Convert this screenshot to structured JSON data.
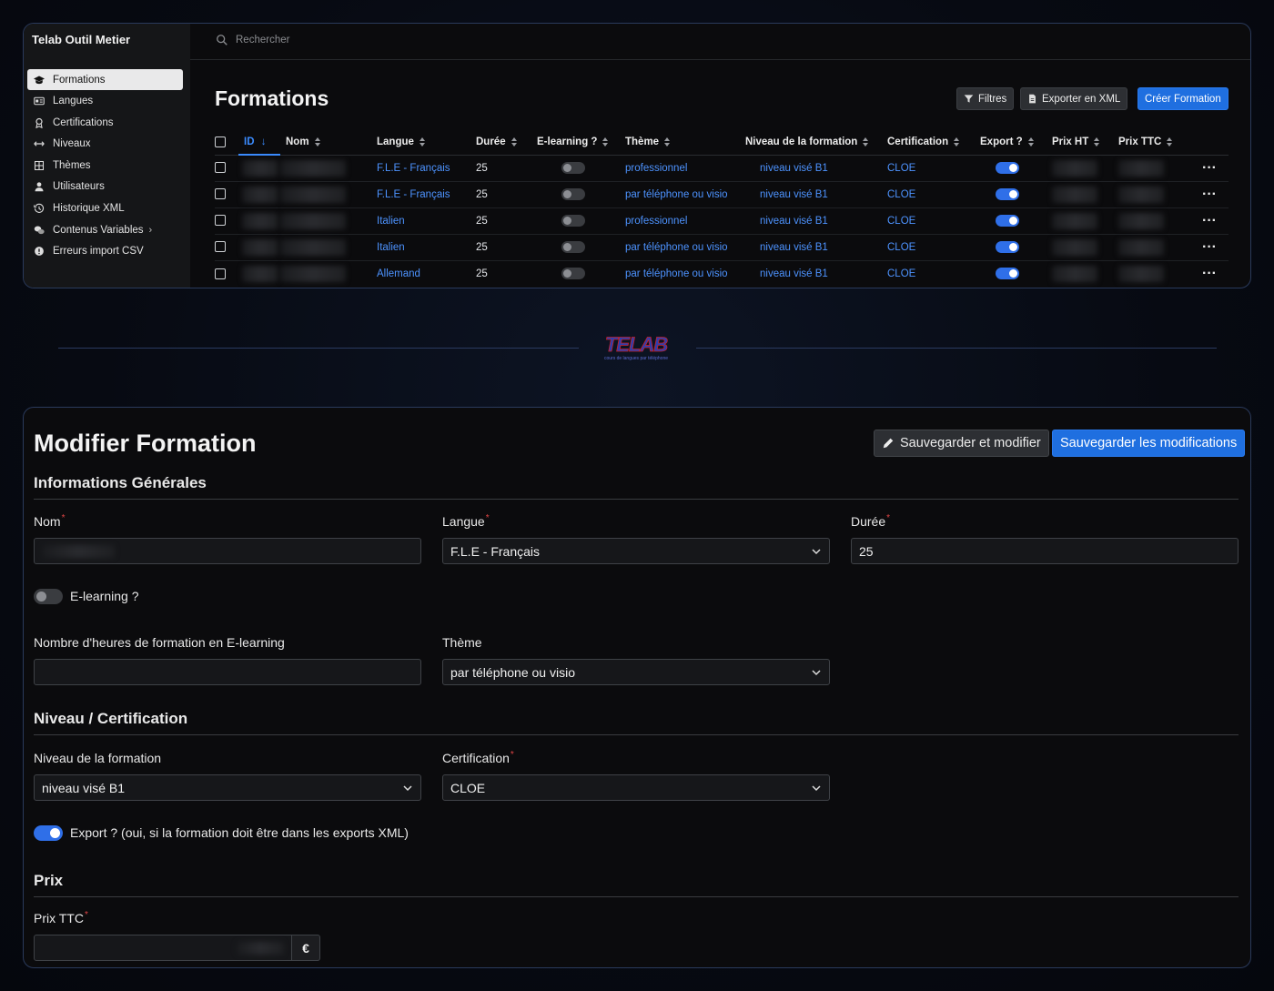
{
  "app": {
    "title": "Telab Outil Metier"
  },
  "sidebar": {
    "items": [
      {
        "label": "Formations",
        "icon": "graduation-cap-icon"
      },
      {
        "label": "Langues",
        "icon": "id-card-icon"
      },
      {
        "label": "Certifications",
        "icon": "award-icon"
      },
      {
        "label": "Niveaux",
        "icon": "arrows-left-right-icon"
      },
      {
        "label": "Thèmes",
        "icon": "grid-icon"
      },
      {
        "label": "Utilisateurs",
        "icon": "user-icon"
      },
      {
        "label": "Historique XML",
        "icon": "history-icon"
      },
      {
        "label": "Contenus Variables",
        "icon": "chat-bubbles-icon"
      },
      {
        "label": "Erreurs import CSV",
        "icon": "alert-circle-icon"
      }
    ]
  },
  "search": {
    "placeholder": "Rechercher"
  },
  "list": {
    "title": "Formations",
    "filters_label": "Filtres",
    "export_label": "Exporter en XML",
    "create_label": "Créer Formation",
    "columns": [
      "ID",
      "Nom",
      "Langue",
      "Durée",
      "E-learning ?",
      "Thème",
      "Niveau de la formation",
      "Certification",
      "Export ?",
      "Prix HT",
      "Prix TTC"
    ],
    "rows": [
      {
        "langue": "F.L.E - Français",
        "duree": "25",
        "elearning": false,
        "theme": "professionnel",
        "niveau": "niveau visé B1",
        "certification": "CLOE",
        "export": true
      },
      {
        "langue": "F.L.E - Français",
        "duree": "25",
        "elearning": false,
        "theme": "par téléphone ou visio",
        "niveau": "niveau visé B1",
        "certification": "CLOE",
        "export": true
      },
      {
        "langue": "Italien",
        "duree": "25",
        "elearning": false,
        "theme": "professionnel",
        "niveau": "niveau visé B1",
        "certification": "CLOE",
        "export": true
      },
      {
        "langue": "Italien",
        "duree": "25",
        "elearning": false,
        "theme": "par téléphone ou visio",
        "niveau": "niveau visé B1",
        "certification": "CLOE",
        "export": true
      },
      {
        "langue": "Allemand",
        "duree": "25",
        "elearning": false,
        "theme": "par téléphone ou visio",
        "niveau": "niveau visé B1",
        "certification": "CLOE",
        "export": true
      }
    ]
  },
  "logo": {
    "text": "TELAB",
    "tagline": "cours de langues par téléphone"
  },
  "form": {
    "title": "Modifier Formation",
    "save_edit_label": "Sauvegarder et modifier",
    "save_label": "Sauvegarder les modifications",
    "sections": {
      "general": "Informations Générales",
      "level": "Niveau / Certification",
      "price": "Prix"
    },
    "fields": {
      "nom_label": "Nom",
      "langue_label": "Langue",
      "langue_value": "F.L.E - Français",
      "duree_label": "Durée",
      "duree_value": "25",
      "elearning_label": "E-learning ?",
      "elearning_on": false,
      "heures_label": "Nombre d'heures de formation en E-learning",
      "heures_value": "",
      "theme_label": "Thème",
      "theme_value": "par téléphone ou visio",
      "niveau_label": "Niveau de la formation",
      "niveau_value": "niveau visé B1",
      "certification_label": "Certification",
      "certification_value": "CLOE",
      "export_label": "Export ? (oui, si la formation doit être dans les exports XML)",
      "export_on": true,
      "prix_ttc_label": "Prix TTC",
      "currency": "€"
    }
  },
  "colors": {
    "accent": "#1f6fe0",
    "link": "#4d93ff",
    "required": "#e04545",
    "border": "#2a3a5c"
  }
}
